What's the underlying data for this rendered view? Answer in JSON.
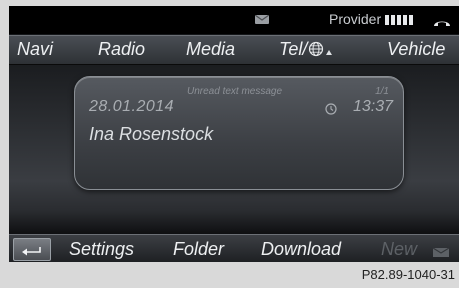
{
  "status_bar": {
    "provider_label": "Provider",
    "envelope_icon": "envelope-icon",
    "signal_icon": "signal-strength-icon",
    "phone_icon": "phone-handset-icon"
  },
  "main_menu": {
    "items": [
      {
        "label": "Navi"
      },
      {
        "label": "Radio"
      },
      {
        "label": "Media"
      },
      {
        "label": "Tel/"
      },
      {
        "label": "Vehicle"
      }
    ],
    "tel_icon": "globe-icon"
  },
  "message": {
    "header": "Unread text message",
    "counter": "1/1",
    "date": "28.01.2014",
    "time": "13:37",
    "sender": "Ina Rosenstock",
    "clock_icon": "clock-icon"
  },
  "bottom_bar": {
    "back_icon": "back-arrow-icon",
    "items": [
      {
        "label": "Settings"
      },
      {
        "label": "Folder"
      },
      {
        "label": "Download"
      },
      {
        "label": "New",
        "enabled": false
      }
    ],
    "new_icon": "new-mail-icon"
  },
  "caption": "P82.89-1040-31"
}
